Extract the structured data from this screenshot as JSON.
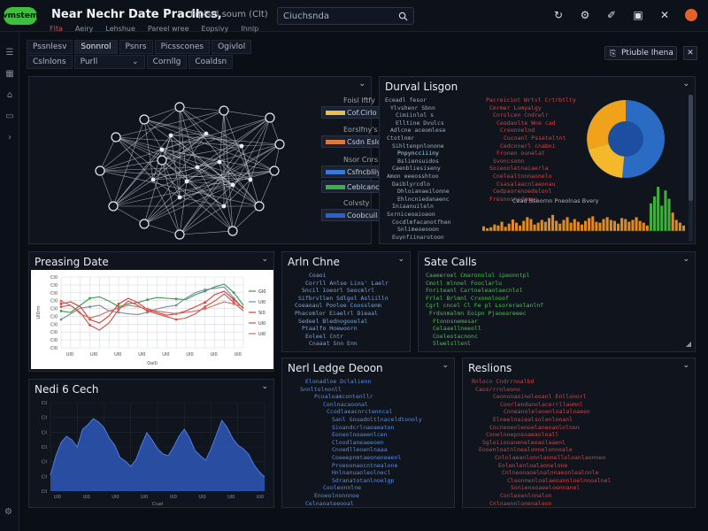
{
  "app": {
    "logo_text": "vmstem",
    "title": "Near Nechr Date Pracihcs,",
    "subtitle": "Frplsel soum (Clt)",
    "search_placeholder": "Ciuchsnda"
  },
  "menu": [
    "Flta",
    "Aeiry",
    "Lehshue",
    "Pareel wree",
    "Eopsivy",
    "Ihnlp"
  ],
  "top_icons": [
    "refresh-icon",
    "gear-icon",
    "wand-icon",
    "export-icon",
    "close-icon",
    "avatar"
  ],
  "tabs_row1": [
    "Pssnlesv",
    "Sonnrol",
    "Psnrs",
    "Picsscones",
    "Ogivlol"
  ],
  "tabs_row2": [
    "Cslnlons",
    "Purll",
    "Cornllg",
    "Coaldsn"
  ],
  "share_button": "Ptiuble Ihena",
  "panels": {
    "graph": {
      "legend": [
        {
          "label": "Foisl lftfy",
          "swatch": "Cof.Cirlo",
          "color": "#e6c14a"
        },
        {
          "label": "Eorslfny's",
          "swatch": "Csdn Eslos",
          "color": "#e0783a"
        },
        {
          "label": "Nsor Cnrs",
          "swatch": "Csfncbliiy",
          "color": "#3a78d8"
        },
        {
          "label": "",
          "swatch": "Ceblcancos",
          "color": "#3fae4a"
        },
        {
          "label": "Colvsty",
          "swatch": "Coobcuil",
          "color": "#2f5fc8"
        }
      ]
    },
    "dural_linger": {
      "title": "Durval Lisgon",
      "tree_lines": [
        "Eceadl fesor",
        "Ylvshenr Sbnn",
        "Cimiinlol s",
        "Elltine Dvulcs",
        "Adlcne aceomlese",
        "Ctotlnmr",
        "Sihltenpnlonone",
        "Pnpyncciiiny",
        "Bsliensuidos",
        "Caenbliesiseny",
        "Amon eeeosshtoo",
        "Daiblyrcdlo",
        "Dhloianaeilonne",
        "Ehlncniedanaenc",
        "Iniaanuileln",
        "Sxrniceoaioaon",
        "Cocdlmfacanotfhen",
        "Snlimeoeooon",
        "Euynfiinarotoon",
        "Toefosocnadn",
        "Eobolshiinn"
      ],
      "red_lines": [
        "Pacreiciot Wrtvl Crtrbtlty",
        "Cmrmer Lomyalgy",
        "Cnrolcen Cndrwlr",
        "Ceodaolte Wne cad",
        "Creonnelnd",
        "Cucoanl Psseteltnt",
        "Cedcnnerl cnabni",
        "Fronen ounelat",
        "Svoncsonn",
        "Soieooletnaiaerla",
        "Cnelealtnnnaonelo",
        "Csasalaacnlaeonau",
        "Cedpaorenoedelonl",
        "Fresnosnedomen"
      ],
      "chart_caption": "Cead Bseornn Pneolnas Bvery"
    },
    "pressing_date": {
      "title": "Preasing Date",
      "y_ticks": [
        "Cl0",
        "Cl0",
        "Cl0",
        "Cl0",
        "Cl0",
        "Cl0",
        "Cl0",
        "Cl0",
        "Cl0",
        "Cl0"
      ],
      "x_ticks": [
        "Ul0",
        "Ul0",
        "Ul0",
        "Ul0",
        "Ul0",
        "Ul0",
        "Ul0",
        "Ul0"
      ],
      "legend": [
        "Gl0",
        "Ul0",
        "Sl0",
        "Ul0",
        "Ul0"
      ],
      "x_label": "Oal0",
      "y_label": "Ul0rm"
    },
    "arln_cline": {
      "title": "Arln Chne",
      "lines": [
        "Coaoi",
        "Corrll Anlse Lins' Laelr",
        "Sncil 1oeorl Seocmlrl",
        "Sifbrvllen Sdlgol Asliilln",
        "Coeaoaul Pooloe Coosslenm",
        "Phacomlor Eiaelrl Dieaal",
        "Sedeel Blednogooelal",
        "Ptaalfo Hoewoorn",
        "Eoleel Cntr",
        "Cnaaat Snn Enn"
      ]
    },
    "sate_calls": {
      "title": "Sate Calls",
      "lines": [
        "Caaeeroel Cmaronolol ipaonntpl",
        "Cmotl mlnoel Fooclarlu",
        "Fnriteanl Cartneleaotaecnlol",
        "Frlel Brlmnl Crxonnlnoof",
        "Cgrl cncel Cl Fe pl Lsoreraolanlnf",
        "Frdsnmalmn Eoipn Pjaoeareeec",
        "Ftonnsnemesar",
        "Celaaellneeoll",
        "Coeleotacnonc",
        "Slwelsllenl"
      ]
    },
    "nedi_6_coch": {
      "title": "Nedi 6 Cech",
      "y_ticks": [
        "Cll",
        "Cll",
        "Cll",
        "Cll",
        "Cll",
        "Cll",
        "Cll"
      ],
      "x_label": "Cluel",
      "x_ticks": [
        "Ul0",
        "Ul0",
        "Ul0",
        "Ul0",
        "Ul0",
        "Ul0",
        "Ul0",
        "Ul0"
      ]
    },
    "nerl_ledge_deoon": {
      "title": "Nerl Ledge Deoon",
      "lines": [
        "Elonadloe Dclalienn",
        "Snnltolnonll",
        "Pcoaloamcontenllr",
        "Conlnacaoonal",
        "Ccodlaeacnrctenncal",
        "Sanl Gouadoltlnaceldtonoly",
        "Sioandcrlnaoaeaton",
        "Eoneolnoaeenlcen",
        "Cloodlaneaeeoen",
        "Cnoedlleoenlnaaa",
        "Coeeepnmtaeoneneeenl",
        "Proeoonaocntnealone",
        "Hnlnanuaoleolnecl",
        "Sdranatotanlnoelgp",
        "Cooleonnlne",
        "Enoeolnonnnoe",
        "Celnaoateeooal"
      ]
    },
    "reslions": {
      "title": "Reslions",
      "lines": [
        "Rnlocn Cndrrnoalbd",
        "Caosrrroleono",
        "Ceononaoinoleoanl Enllonorl",
        "Coorlendanolacerrllaomnl",
        "Cnneanoleleoenloalaloaeen",
        "Elneelnaiealsolenlnnanl",
        "Cocneoeolenoelaneoanlnlnen",
        "Conelnoepnsoaeaoloall",
        "Sgloiiooaneneleoaolaaenl",
        "Eooenloatnlnealonnelonnoale",
        "Cnlnlaeanlonnlaonelloloanlaonneo",
        "Eolenlenloalaonelone",
        "Cnlneonaoelnalnnaeonlealnnle",
        "Cleonnenloalaeoannloelnnoalnel",
        "Sonienooaeeloennanel",
        "Conleoenlnnalon",
        "Cnlnaennlonenaleon"
      ]
    }
  },
  "chart_data": [
    {
      "type": "line",
      "title": "Preasing Date",
      "x": [
        0,
        1,
        2,
        3,
        4,
        5,
        6,
        7,
        8,
        9,
        10,
        11,
        12,
        13,
        14,
        15,
        16,
        17,
        18,
        19
      ],
      "series": [
        {
          "values": [
            52,
            50,
            60,
            70,
            72,
            66,
            58,
            62,
            64,
            68,
            71,
            70,
            69,
            68,
            75,
            80,
            86,
            90,
            78,
            60
          ],
          "color": "#3a9a4a"
        },
        {
          "values": [
            40,
            48,
            56,
            58,
            60,
            52,
            50,
            48,
            47,
            50,
            55,
            58,
            60,
            70,
            78,
            82,
            84,
            86,
            70,
            55
          ],
          "color": "#7a8aa0"
        },
        {
          "values": [
            62,
            65,
            58,
            40,
            35,
            45,
            62,
            70,
            64,
            54,
            50,
            46,
            48,
            52,
            58,
            64,
            75,
            80,
            68,
            56
          ],
          "color": "#d83a3a"
        },
        {
          "values": [
            58,
            60,
            50,
            32,
            25,
            35,
            54,
            66,
            60,
            52,
            48,
            44,
            40,
            42,
            48,
            58,
            66,
            76,
            64,
            52
          ],
          "color": "#c9504a"
        },
        {
          "values": [
            66,
            60,
            48,
            42,
            46,
            52,
            56,
            60,
            58,
            55,
            52,
            50,
            48,
            50,
            52,
            55,
            60,
            65,
            62,
            58
          ],
          "color": "#d46a5a"
        }
      ],
      "ylim": [
        0,
        100
      ]
    },
    {
      "type": "area",
      "title": "Nedi 6 Cech",
      "x": [
        0,
        1,
        2,
        3,
        4,
        5,
        6,
        7,
        8,
        9,
        10,
        11,
        12,
        13,
        14,
        15,
        16,
        17,
        18,
        19,
        20,
        21,
        22,
        23,
        24,
        25,
        26,
        27,
        28,
        29,
        30,
        31,
        32,
        33,
        34,
        35,
        36,
        37,
        38,
        39,
        40
      ],
      "values": [
        18,
        40,
        55,
        62,
        58,
        50,
        70,
        75,
        82,
        78,
        72,
        60,
        52,
        38,
        34,
        28,
        36,
        52,
        66,
        58,
        48,
        42,
        40,
        50,
        62,
        70,
        60,
        46,
        40,
        35,
        48,
        64,
        80,
        72,
        60,
        52,
        48,
        42,
        30,
        22,
        16
      ],
      "ylim": [
        0,
        100
      ],
      "color": "#2e57b8"
    },
    {
      "type": "bar",
      "title": "Cead Bseornn Pneolnas Bvery",
      "values": [
        10,
        6,
        8,
        14,
        12,
        20,
        9,
        16,
        25,
        18,
        12,
        22,
        30,
        26,
        14,
        18,
        24,
        20,
        28,
        35,
        22,
        16,
        24,
        30,
        18,
        26,
        20,
        14,
        22,
        28,
        32,
        20,
        18,
        26,
        30,
        24,
        22,
        16,
        28,
        26,
        20,
        24,
        30,
        22,
        18,
        12,
        60,
        75,
        96,
        55,
        88,
        70,
        40,
        24,
        18,
        12
      ],
      "colors_note": "orange bars with green peaks near the end",
      "ylim": [
        0,
        100
      ]
    }
  ]
}
